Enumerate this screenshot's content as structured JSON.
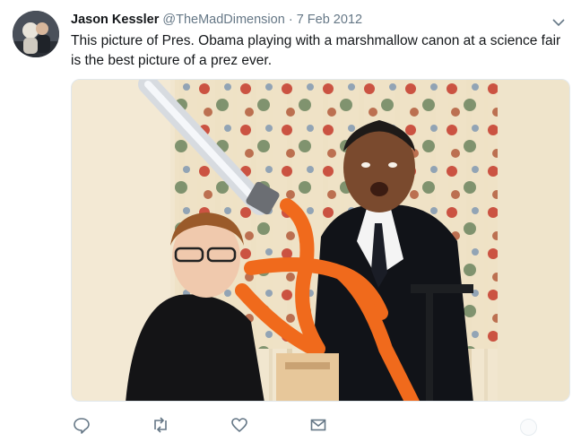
{
  "tweet": {
    "author_name": "Jason Kessler",
    "author_handle": "@TheMadDimension",
    "separator": "·",
    "date": "7 Feb 2012",
    "text": "This picture of Pres. Obama playing with a marshmallow canon at a science fair is the best picture of a prez ever."
  },
  "icons": {
    "caret": "chevron-down-icon",
    "reply": "reply-icon",
    "retweet": "retweet-icon",
    "like": "heart-icon",
    "dm": "envelope-icon"
  },
  "colors": {
    "text": "#14171a",
    "muted": "#657786",
    "cannon_orange": "#f06a1c"
  }
}
